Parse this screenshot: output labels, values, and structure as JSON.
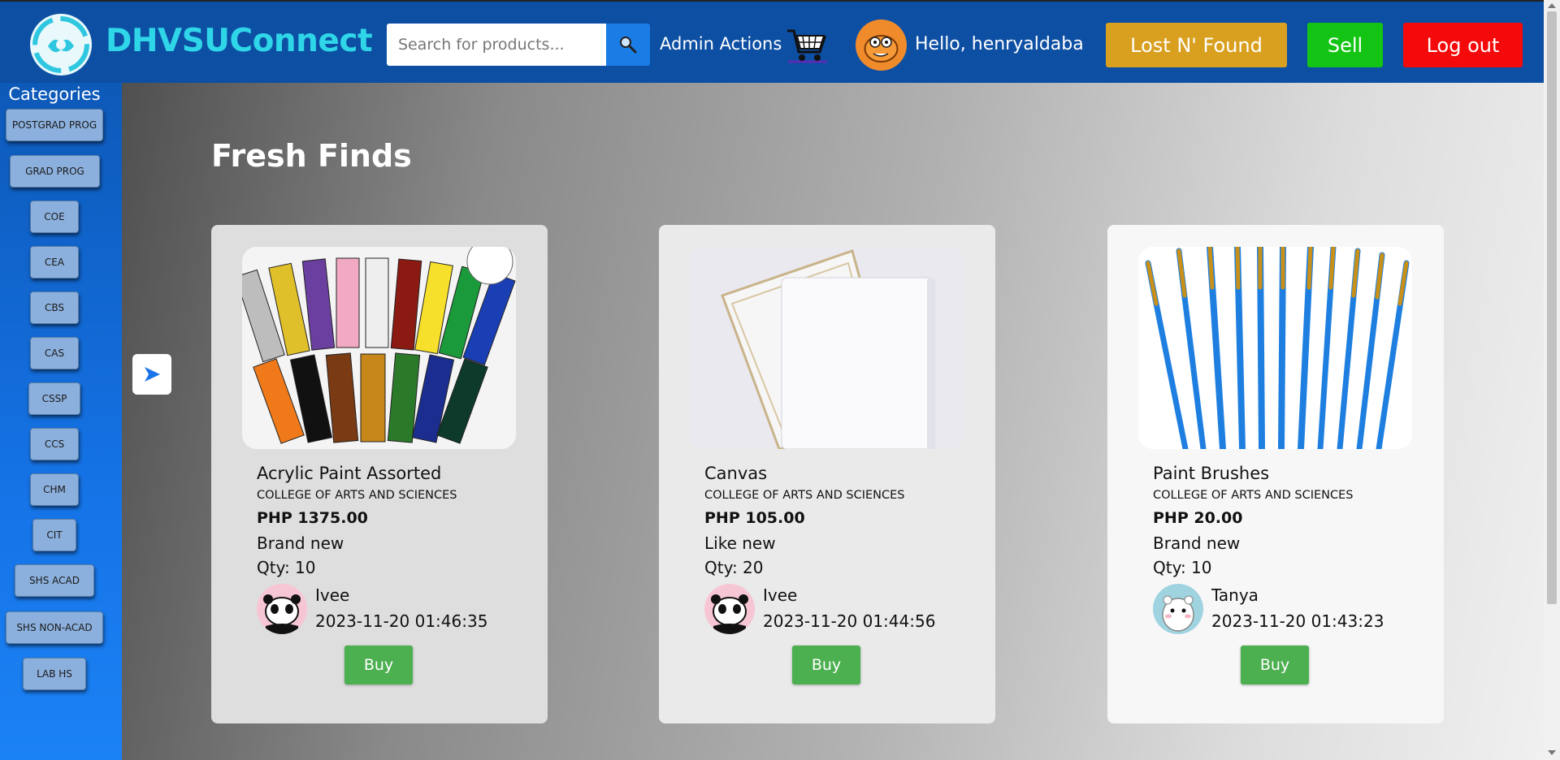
{
  "header": {
    "brand": "DHVSUConnect",
    "search_placeholder": "Search for products...",
    "admin_actions": "Admin Actions",
    "greeting": "Hello, henryaldaba",
    "lost_found": "Lost N' Found",
    "sell": "Sell",
    "logout": "Log out"
  },
  "sidebar": {
    "title": "Categories",
    "items": [
      {
        "label": "POSTGRAD PROG"
      },
      {
        "label": "GRAD PROG"
      },
      {
        "label": "COE"
      },
      {
        "label": "CEA"
      },
      {
        "label": "CBS"
      },
      {
        "label": "CAS"
      },
      {
        "label": "CSSP"
      },
      {
        "label": "CCS"
      },
      {
        "label": "CHM"
      },
      {
        "label": "CIT"
      },
      {
        "label": "SHS ACAD"
      },
      {
        "label": "SHS NON-ACAD"
      },
      {
        "label": "LAB HS"
      }
    ]
  },
  "main": {
    "section_title": "Fresh Finds",
    "products": [
      {
        "name": "Acrylic Paint Assorted",
        "college": "COLLEGE OF ARTS AND SCIENCES",
        "price": "PHP 1375.00",
        "condition": "Brand new",
        "qty": "Qty: 10",
        "seller": "Ivee",
        "time": "2023-11-20 01:46:35",
        "buy": "Buy"
      },
      {
        "name": "Canvas",
        "college": "COLLEGE OF ARTS AND SCIENCES",
        "price": "PHP 105.00",
        "condition": "Like new",
        "qty": "Qty: 20",
        "seller": "Ivee",
        "time": "2023-11-20 01:44:56",
        "buy": "Buy"
      },
      {
        "name": "Paint Brushes",
        "college": "COLLEGE OF ARTS AND SCIENCES",
        "price": "PHP 20.00",
        "condition": "Brand new",
        "qty": "Qty: 10",
        "seller": "Tanya",
        "time": "2023-11-20 01:43:23",
        "buy": "Buy"
      }
    ]
  },
  "colors": {
    "header_bg": "#0d4fa3",
    "brand": "#2fd6e8",
    "lost_found": "#d9a020",
    "sell": "#14c414",
    "logout": "#f40a0a",
    "buy": "#4caf50"
  }
}
